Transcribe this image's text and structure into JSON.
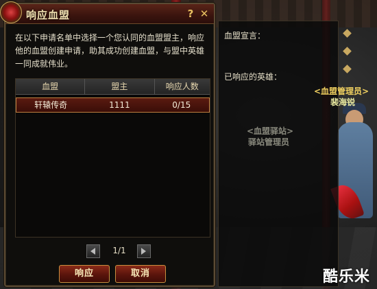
{
  "window": {
    "title": "响应血盟",
    "help_label": "?",
    "close_label": "✕",
    "description": "在以下申请名单中选择一个您认同的血盟盟主，响应他的血盟创建申请，助其成功创建血盟，与盟中英雄一同成就伟业。"
  },
  "table": {
    "headers": [
      "血盟",
      "盟主",
      "响应人数"
    ],
    "rows": [
      {
        "clan": "轩辕传奇",
        "leader": "1111",
        "count": "0/15"
      }
    ]
  },
  "pager": {
    "page": "1/1"
  },
  "buttons": {
    "respond": "响应",
    "cancel": "取消"
  },
  "side_panel": {
    "manifesto_label": "血盟宣言：",
    "heroes_label": "已响应的英雄："
  },
  "npc": {
    "manager_title": "<血盟管理员>",
    "manager_name": "裴海锐",
    "station_title": "<血盟驿站>",
    "station_name": "驿站管理员"
  },
  "watermark": "酷乐米",
  "colors": {
    "npc_title": "#f0d060",
    "npc_name": "#e8e8a0",
    "station": "#b0b0a0"
  }
}
